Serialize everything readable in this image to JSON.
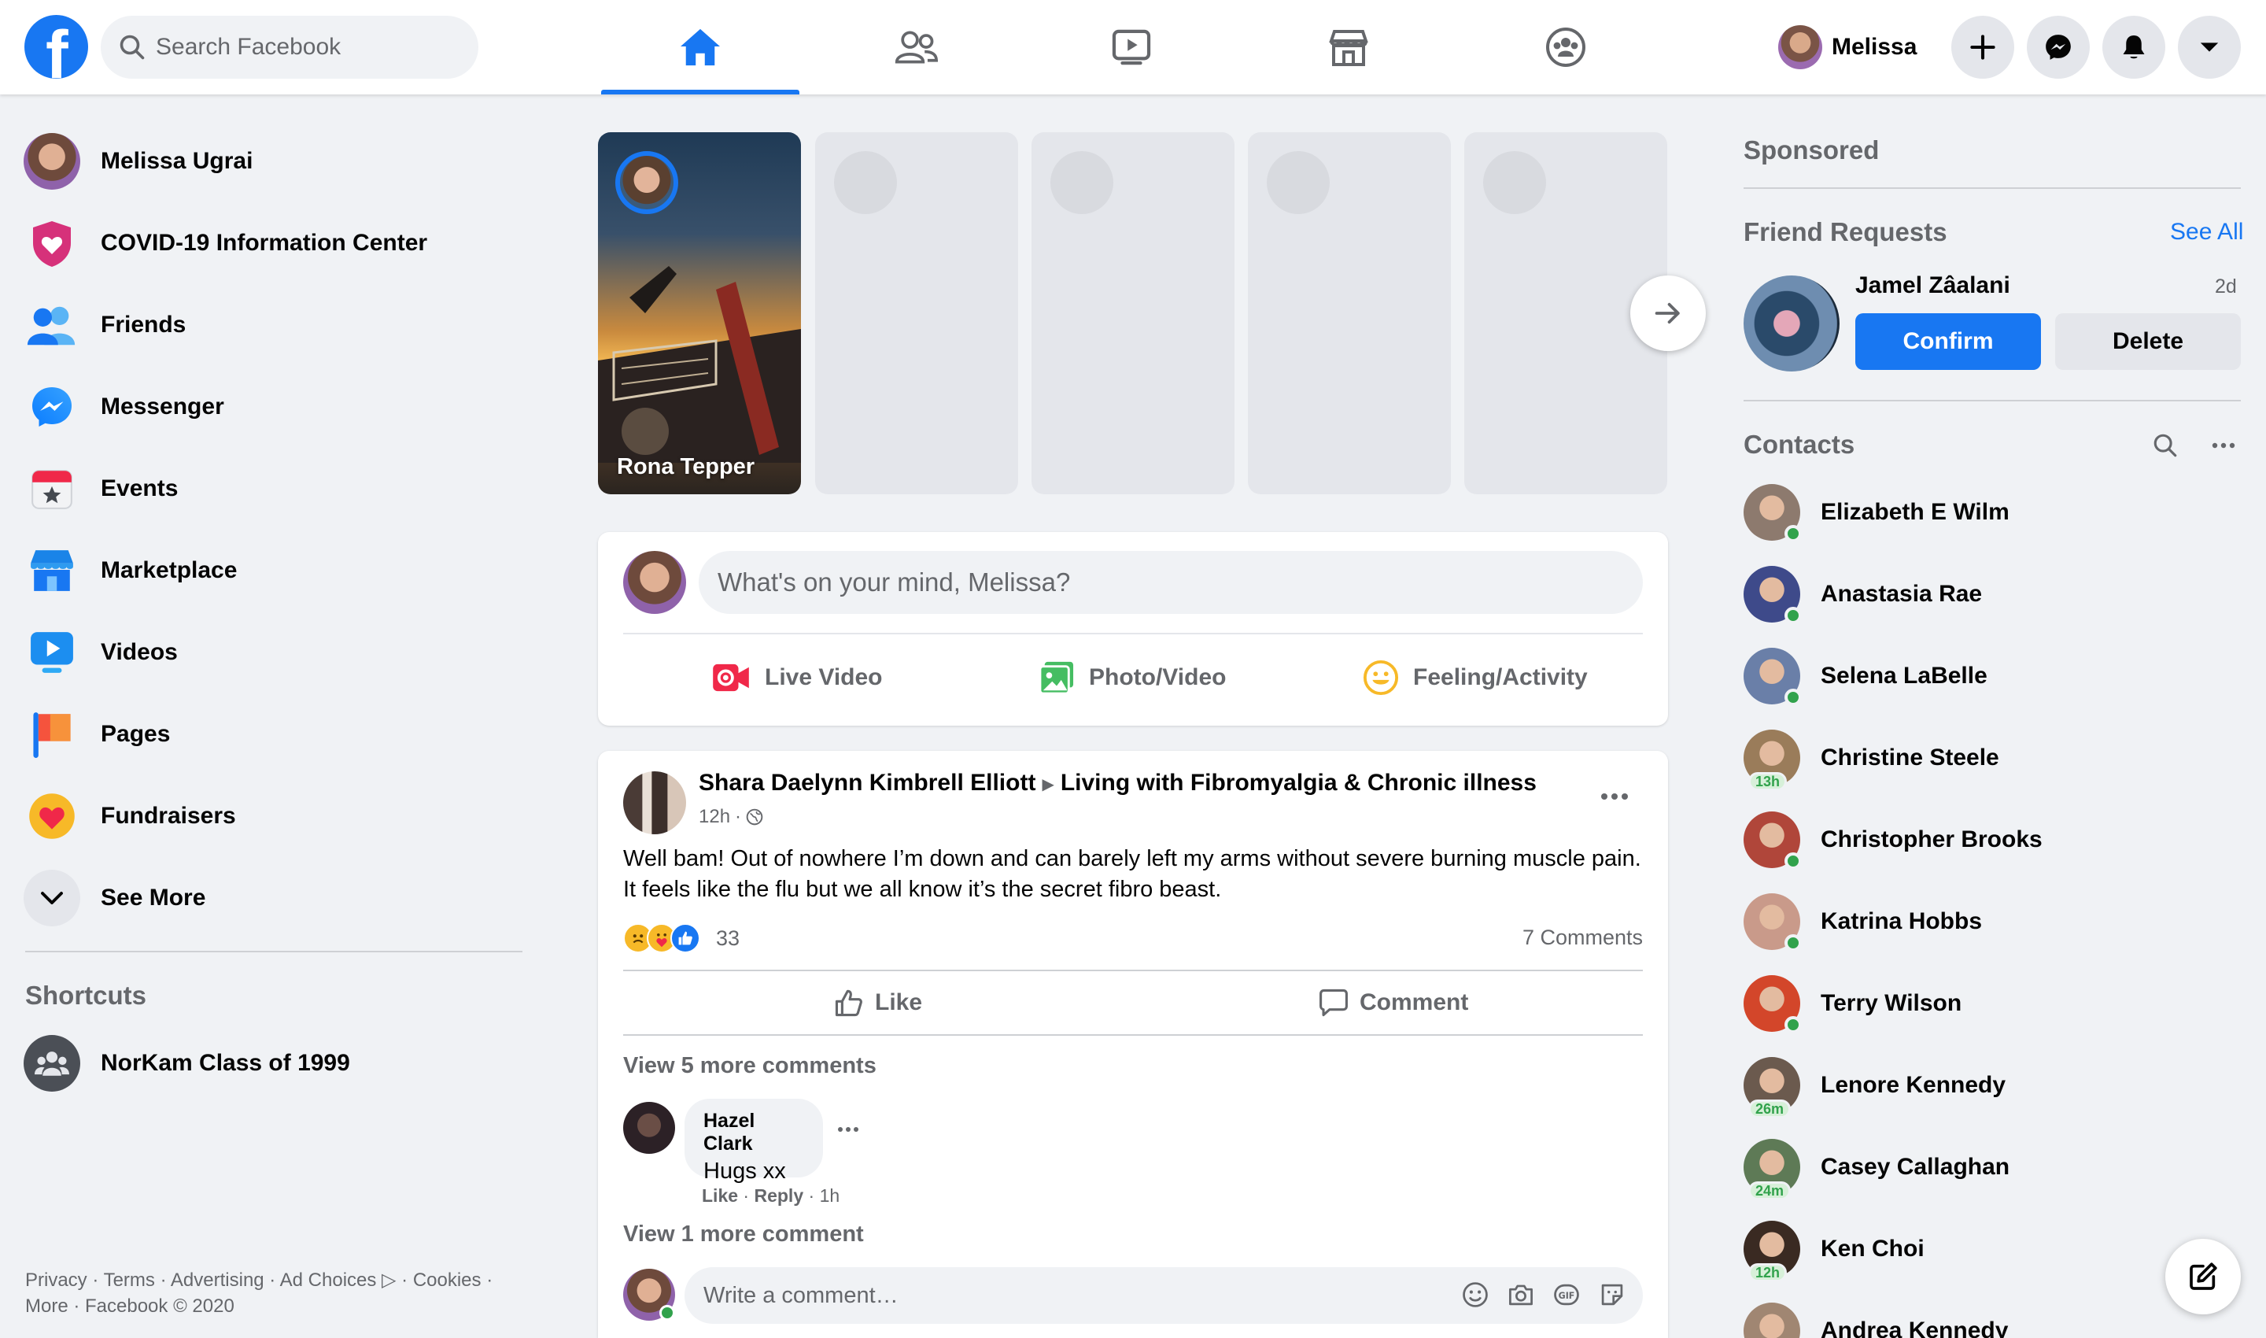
{
  "header": {
    "logo_letter": "f",
    "search_placeholder": "Search Facebook",
    "nav_tabs": [
      {
        "name": "home",
        "active": true
      },
      {
        "name": "friends",
        "active": false
      },
      {
        "name": "watch",
        "active": false
      },
      {
        "name": "marketplace",
        "active": false
      },
      {
        "name": "groups",
        "active": false
      }
    ],
    "profile_name": "Melissa"
  },
  "sidebar": {
    "items": [
      {
        "label": "Melissa Ugrai",
        "icon": "avatar"
      },
      {
        "label": "COVID-19 Information Center",
        "icon": "covid-heart-icon"
      },
      {
        "label": "Friends",
        "icon": "friends-icon"
      },
      {
        "label": "Messenger",
        "icon": "messenger-icon"
      },
      {
        "label": "Events",
        "icon": "calendar-star-icon"
      },
      {
        "label": "Marketplace",
        "icon": "shop-icon"
      },
      {
        "label": "Videos",
        "icon": "play-icon"
      },
      {
        "label": "Pages",
        "icon": "flag-icon"
      },
      {
        "label": "Fundraisers",
        "icon": "heart-icon"
      },
      {
        "label": "See More",
        "icon": "chevron-down-icon"
      }
    ],
    "shortcuts_title": "Shortcuts",
    "shortcuts": [
      {
        "label": "NorKam Class of 1999",
        "icon": "group-icon"
      }
    ],
    "footer": "Privacy · Terms · Advertising · Ad Choices ▷ · Cookies · More · Facebook © 2020"
  },
  "stories": {
    "first_name": "Rona Tepper"
  },
  "composer": {
    "placeholder": "What's on your mind, Melissa?",
    "actions": [
      {
        "label": "Live Video",
        "icon": "live-video-icon",
        "color": "#f02849"
      },
      {
        "label": "Photo/Video",
        "icon": "photo-icon",
        "color": "#45bd62"
      },
      {
        "label": "Feeling/Activity",
        "icon": "feeling-icon",
        "color": "#f7b928"
      }
    ]
  },
  "post": {
    "author": "Shara Daelynn Kimbrell Elliott",
    "group": "Living with Fibromyalgia & Chronic illness",
    "time": "12h",
    "text": "Well bam! Out of nowhere I’m down and can barely left my arms without severe burning muscle pain. It feels like the flu but we all know it’s the secret fibro beast.",
    "reaction_count": "33",
    "comment_count": "7 Comments",
    "like_label": "Like",
    "comment_label": "Comment",
    "view_more_comments": "View 5 more comments",
    "comment": {
      "author": "Hazel Clark",
      "text": "Hugs xx",
      "like": "Like",
      "reply": "Reply",
      "time": "1h"
    },
    "view_more_comment": "View 1 more comment",
    "write_placeholder": "Write a comment…"
  },
  "right": {
    "sponsored_title": "Sponsored",
    "friend_requests_title": "Friend Requests",
    "see_all": "See All",
    "request": {
      "name": "Jamel Zâalani",
      "time": "2d",
      "confirm": "Confirm",
      "delete": "Delete"
    },
    "contacts_title": "Contacts",
    "contacts": [
      {
        "name": "Elizabeth E Wilm",
        "status": "online",
        "color": "#8d7a6e"
      },
      {
        "name": "Anastasia Rae",
        "status": "online",
        "color": "#3e4a8a"
      },
      {
        "name": "Selena LaBelle",
        "status": "online",
        "color": "#6a7fa8"
      },
      {
        "name": "Christine Steele",
        "status": "13h",
        "color": "#9a7c5a"
      },
      {
        "name": "Christopher Brooks",
        "status": "online",
        "color": "#b0463a"
      },
      {
        "name": "Katrina Hobbs",
        "status": "online",
        "color": "#c99a8a"
      },
      {
        "name": "Terry Wilson",
        "status": "online",
        "color": "#d3462a"
      },
      {
        "name": "Lenore Kennedy",
        "status": "26m",
        "color": "#6b5a4e"
      },
      {
        "name": "Casey Callaghan",
        "status": "24m",
        "color": "#5e7a56"
      },
      {
        "name": "Ken Choi",
        "status": "12h",
        "color": "#3a2a22"
      },
      {
        "name": "Andrea Kennedy",
        "status": "",
        "color": "#a08672"
      }
    ]
  }
}
